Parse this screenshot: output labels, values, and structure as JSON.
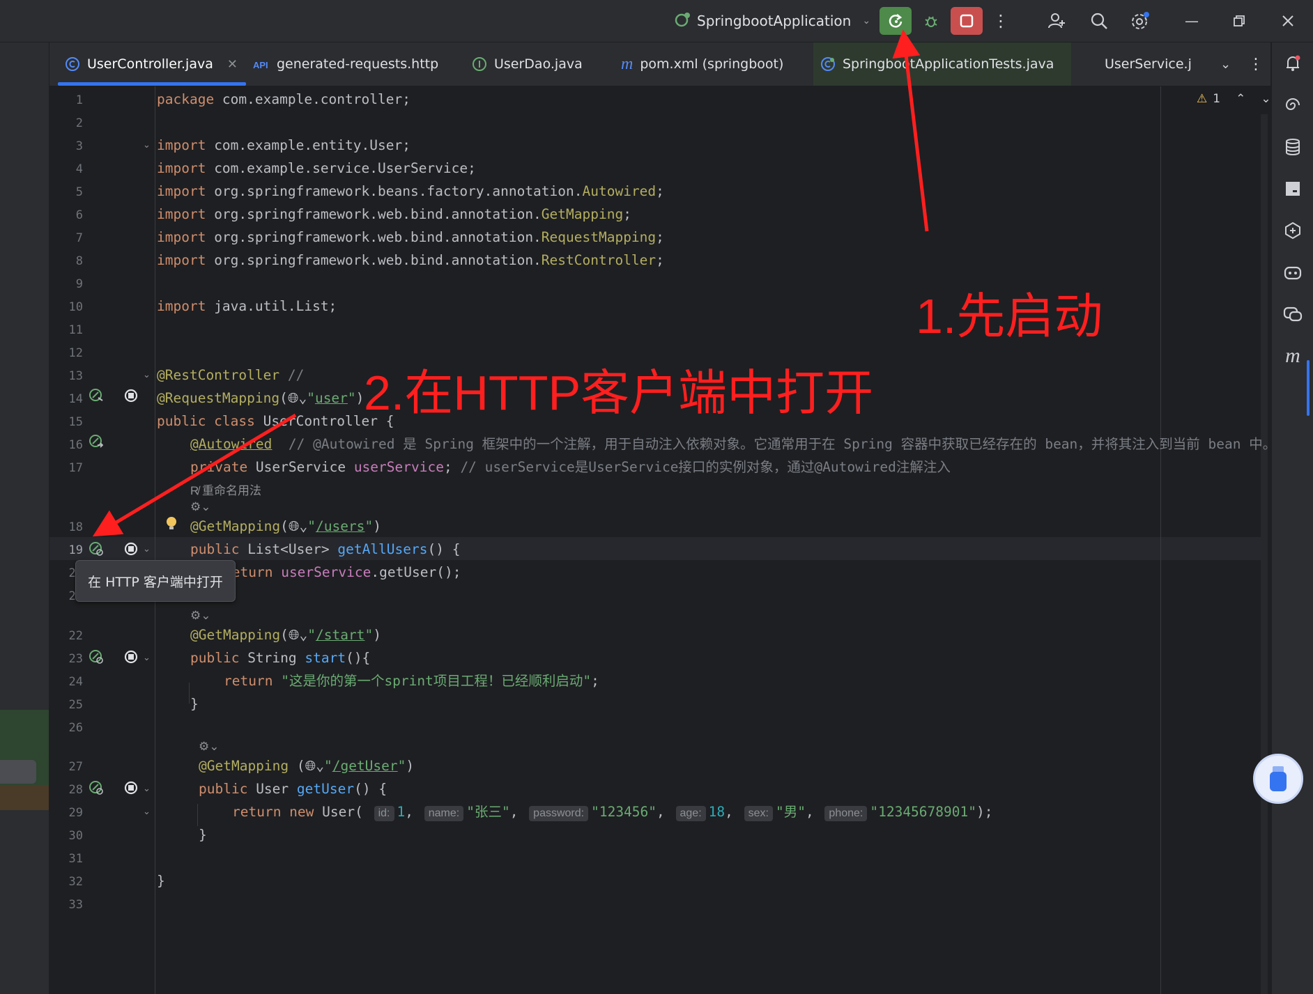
{
  "titlebar": {
    "run_config": "SpringbootApplication"
  },
  "tabs": [
    {
      "label": "UserController.java",
      "icon": "class-icon"
    },
    {
      "label": "generated-requests.http",
      "icon": "api-icon"
    },
    {
      "label": "UserDao.java",
      "icon": "interface-icon"
    },
    {
      "label": "pom.xml (springboot)",
      "icon": "maven-icon"
    },
    {
      "label": "SpringbootApplicationTests.java",
      "icon": "test-class-icon"
    },
    {
      "label": "UserService.j",
      "icon": "class-icon"
    }
  ],
  "editor": {
    "warning_count": "1",
    "inlay_rename": "重命名用法",
    "tooltip": "在 HTTP 客户端中打开",
    "line_numbers": [
      "1",
      "2",
      "3",
      "4",
      "5",
      "6",
      "7",
      "8",
      "9",
      "10",
      "11",
      "12",
      "13",
      "14",
      "15",
      "16",
      "17",
      "18",
      "19",
      "20",
      "21",
      "22",
      "23",
      "24",
      "25",
      "26",
      "27",
      "28",
      "29",
      "30",
      "31",
      "32",
      "33"
    ]
  },
  "annotations": {
    "step1": "1.先启动",
    "step2": "2.在HTTP客户端中打开",
    "color": "#ff1f1f"
  },
  "colors": {
    "keyword": "#cf8e6d",
    "annotation": "#b3ae60",
    "string": "#6aab73",
    "field": "#c77dbb",
    "method": "#56a8f5",
    "accent": "#3574f0"
  }
}
